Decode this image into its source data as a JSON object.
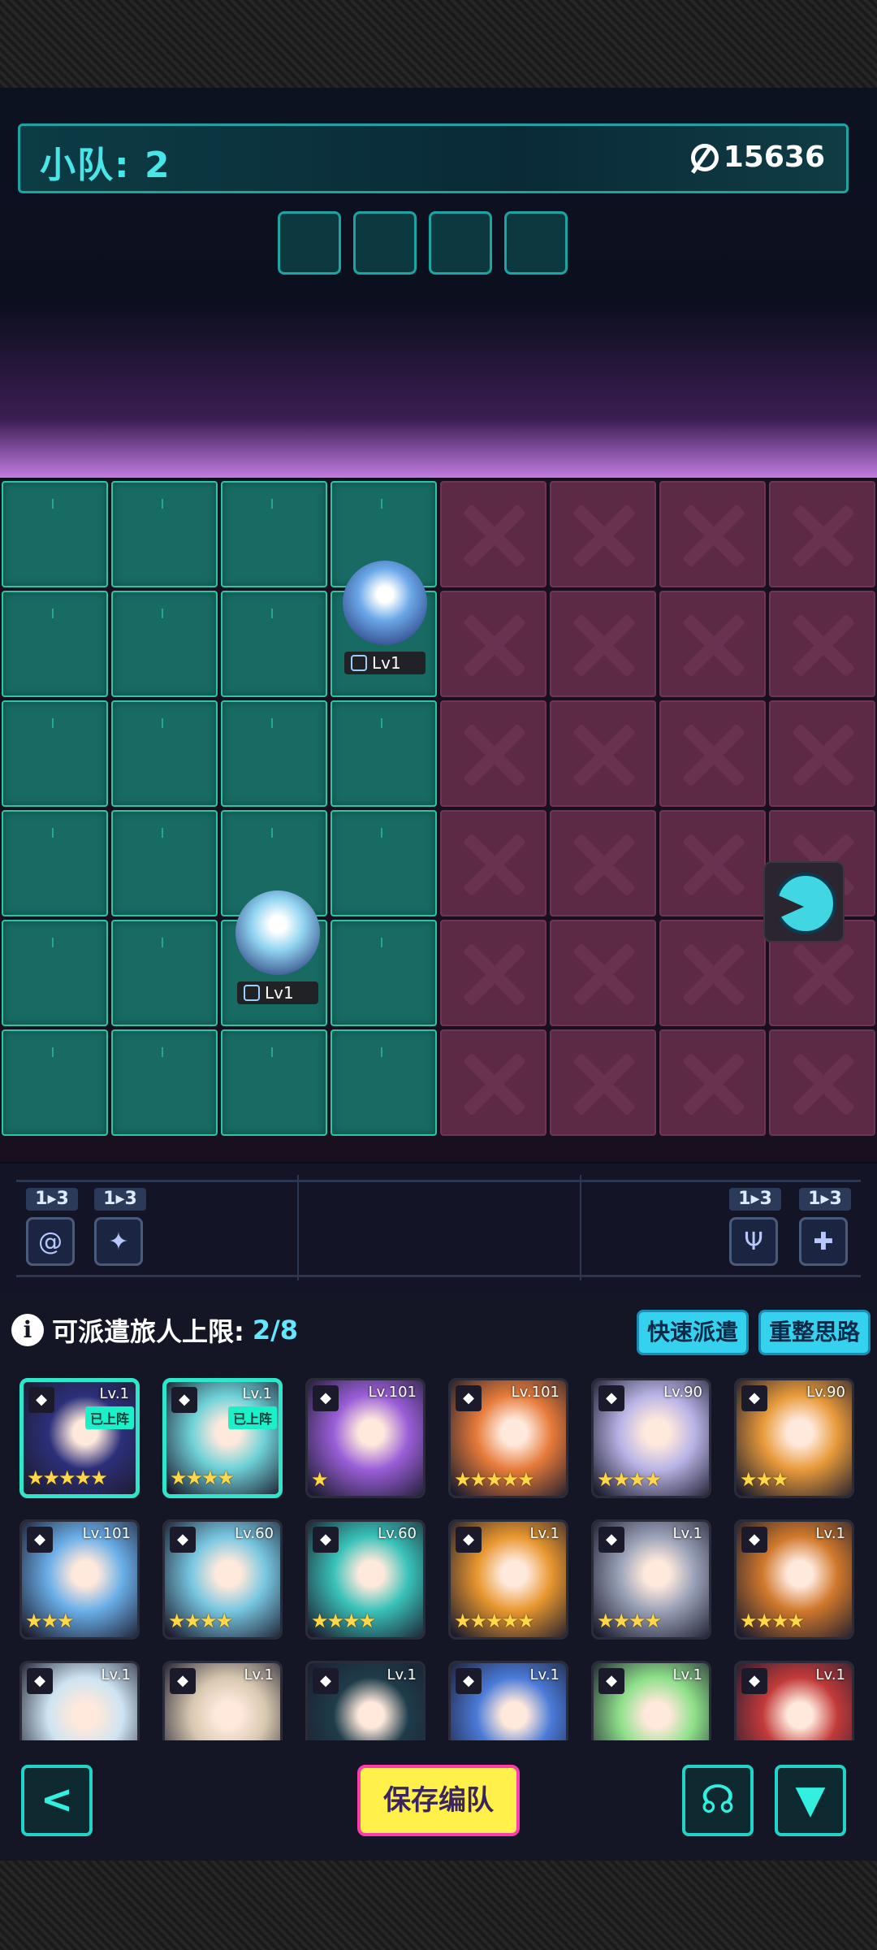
{
  "header": {
    "squad_label": "小队:",
    "squad_number": "2",
    "power_value": "15636"
  },
  "board": {
    "units": [
      {
        "name": "hooded-mage-unit",
        "level": "Lv1",
        "color": "#6aa8e8"
      },
      {
        "name": "fox-girl-unit",
        "level": "Lv1",
        "color": "#8fd3f0"
      }
    ]
  },
  "bonuses": [
    {
      "count": "1▸3",
      "icon": "swirl-icon"
    },
    {
      "count": "1▸3",
      "icon": "blade-icon"
    },
    {
      "count": "1▸3",
      "icon": "shield-icon"
    },
    {
      "count": "1▸3",
      "icon": "crossbow-icon"
    }
  ],
  "roster": {
    "limit_label": "可派遣旅人上限:",
    "limit_value": "2/8",
    "quick_dispatch_label": "快速派遣",
    "reset_label": "重整思路",
    "deployed_label": "已上阵",
    "heroes": [
      {
        "lv": "Lv.1",
        "stars": "★★★★★",
        "deployed": true,
        "color": "#2c2f7a"
      },
      {
        "lv": "Lv.1",
        "stars": "★★★★",
        "deployed": true,
        "color": "#6fd2d8"
      },
      {
        "lv": "Lv.101",
        "stars": "★",
        "deployed": false,
        "color": "#9a5ed8"
      },
      {
        "lv": "Lv.101",
        "stars": "★★★★★",
        "deployed": false,
        "color": "#e77b3a"
      },
      {
        "lv": "Lv.90",
        "stars": "★★★★",
        "deployed": false,
        "color": "#b9b4e6"
      },
      {
        "lv": "Lv.90",
        "stars": "★★★",
        "deployed": false,
        "color": "#e89a3a"
      },
      {
        "lv": "Lv.101",
        "stars": "★★★",
        "deployed": false,
        "color": "#6aaee8"
      },
      {
        "lv": "Lv.60",
        "stars": "★★★★",
        "deployed": false,
        "color": "#77c6e0"
      },
      {
        "lv": "Lv.60",
        "stars": "★★★★",
        "deployed": false,
        "color": "#38c2b8"
      },
      {
        "lv": "Lv.1",
        "stars": "★★★★★",
        "deployed": false,
        "color": "#e8962e"
      },
      {
        "lv": "Lv.1",
        "stars": "★★★★",
        "deployed": false,
        "color": "#9aa2b8"
      },
      {
        "lv": "Lv.1",
        "stars": "★★★★",
        "deployed": false,
        "color": "#d0782c"
      },
      {
        "lv": "Lv.1",
        "stars": "",
        "deployed": false,
        "color": "#cde4f2"
      },
      {
        "lv": "Lv.1",
        "stars": "",
        "deployed": false,
        "color": "#d8c8b0"
      },
      {
        "lv": "Lv.1",
        "stars": "",
        "deployed": false,
        "color": "#1e3c4a"
      },
      {
        "lv": "Lv.1",
        "stars": "",
        "deployed": false,
        "color": "#4a7ad8"
      },
      {
        "lv": "Lv.1",
        "stars": "",
        "deployed": false,
        "color": "#8ee08a"
      },
      {
        "lv": "Lv.1",
        "stars": "",
        "deployed": false,
        "color": "#c23a3a"
      }
    ]
  },
  "footer": {
    "save_label": "保存编队"
  },
  "colors": {
    "accent": "#22d4c8",
    "ally_tile": "#176b63",
    "enemy_tile": "#5c2a45",
    "save_button": "#fff14a"
  }
}
